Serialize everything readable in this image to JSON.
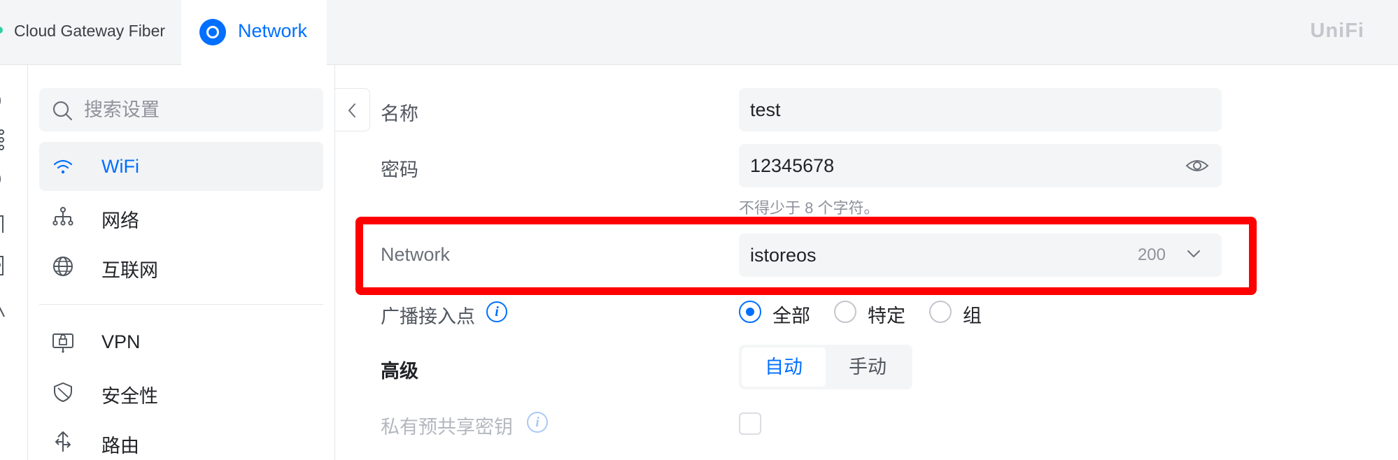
{
  "topbar": {
    "console_name": "Cloud Gateway Fiber",
    "app_tab_label": "Network",
    "brand": "UniFi",
    "accent_color": "#006fff"
  },
  "sidebar": {
    "search_placeholder": "搜索设置",
    "items": [
      {
        "label": "WiFi",
        "icon": "wifi-icon",
        "active": true
      },
      {
        "label": "网络",
        "icon": "network-topology-icon",
        "active": false
      },
      {
        "label": "互联网",
        "icon": "globe-icon",
        "active": false
      },
      {
        "label": "VPN",
        "icon": "vpn-icon",
        "active": false
      },
      {
        "label": "安全性",
        "icon": "shield-icon",
        "active": false
      },
      {
        "label": "路由",
        "icon": "routing-icon",
        "active": false
      }
    ]
  },
  "form": {
    "name_label": "名称",
    "name_value": "test",
    "password_label": "密码",
    "password_value": "12345678",
    "password_hint": "不得少于 8 个字符。",
    "network_label": "Network",
    "network_value": "istoreos",
    "network_count": "200",
    "broadcast_label": "广播接入点",
    "broadcast_options": [
      "全部",
      "特定",
      "组"
    ],
    "broadcast_selected": "全部",
    "advanced_label": "高级",
    "advanced_options": [
      "自动",
      "手动"
    ],
    "advanced_selected": "自动",
    "ppsk_label": "私有预共享密钥",
    "ppsk_checked": false
  },
  "highlight_color": "#ff0000"
}
